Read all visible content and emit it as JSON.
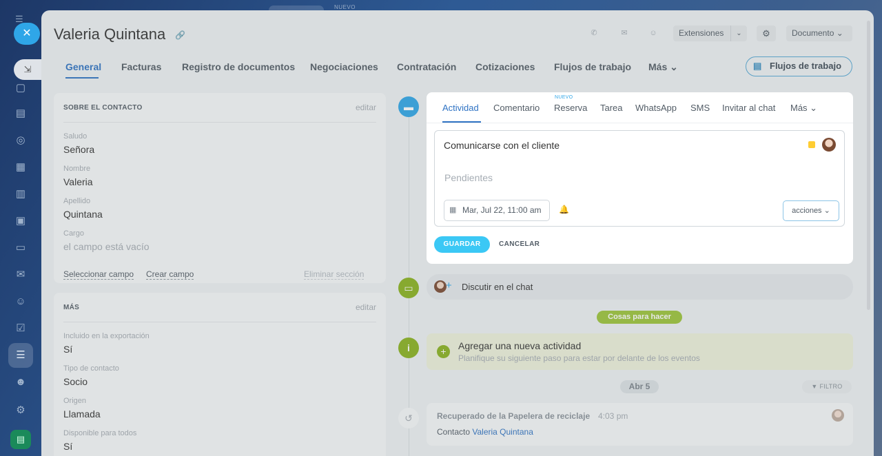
{
  "background": {
    "top_tag": "NUEVO"
  },
  "header": {
    "title": "Valeria Quintana",
    "extensions_label": "Extensiones",
    "document_label": "Documento"
  },
  "tabs": [
    {
      "label": "General"
    },
    {
      "label": "Facturas"
    },
    {
      "label": "Registro de documentos"
    },
    {
      "label": "Negociaciones"
    },
    {
      "label": "Contratación"
    },
    {
      "label": "Cotizaciones"
    },
    {
      "label": "Flujos de trabajo"
    },
    {
      "label": "Más"
    }
  ],
  "flow_button": {
    "label": "Flujos de trabajo"
  },
  "contact_card": {
    "heading": "SOBRE EL CONTACTO",
    "edit": "editar",
    "fields": [
      {
        "label": "Saludo",
        "value": "Señora"
      },
      {
        "label": "Nombre",
        "value": "Valeria"
      },
      {
        "label": "Apellido",
        "value": "Quintana"
      },
      {
        "label": "Cargo",
        "value": "el campo está vacío"
      }
    ],
    "links": {
      "select": "Seleccionar campo",
      "create": "Crear campo",
      "delete": "Eliminar sección"
    }
  },
  "more_card": {
    "heading": "MÁS",
    "edit": "editar",
    "fields": [
      {
        "label": "Incluido en la exportación",
        "value": "Sí"
      },
      {
        "label": "Tipo de contacto",
        "value": "Socio"
      },
      {
        "label": "Origen",
        "value": "Llamada"
      },
      {
        "label": "Disponible para todos",
        "value": "Sí"
      }
    ]
  },
  "editor": {
    "tabs": [
      {
        "label": "Actividad"
      },
      {
        "label": "Comentario"
      },
      {
        "label": "Reserva"
      },
      {
        "label": "Tarea"
      },
      {
        "label": "WhatsApp"
      },
      {
        "label": "SMS"
      },
      {
        "label": "Invitar al chat"
      },
      {
        "label": "Más"
      }
    ],
    "new_badge": "NUEVO",
    "title_value": "Comunicarse con el cliente",
    "placeholder": "Pendientes",
    "date": "Mar, Jul 22, 11:00 am",
    "actions": "acciones",
    "save": "GUARDAR",
    "cancel": "CANCELAR"
  },
  "chat_row": {
    "label": "Discutir en el chat"
  },
  "todo_badge": "Cosas para hacer",
  "add_activity": {
    "title": "Agregar una nueva actividad",
    "subtitle": "Planifique su siguiente paso para estar por delante de los eventos"
  },
  "date_badge": "Abr 5",
  "filter": "FILTRO",
  "history": {
    "title": "Recuperado de la Papelera de reciclaje",
    "time": "4:03 pm",
    "prefix": "Contacto",
    "link": "Valeria Quintana"
  },
  "colors": {
    "accent": "#2f73c4",
    "save": "#3bc8f5",
    "green": "#8ab21f"
  }
}
